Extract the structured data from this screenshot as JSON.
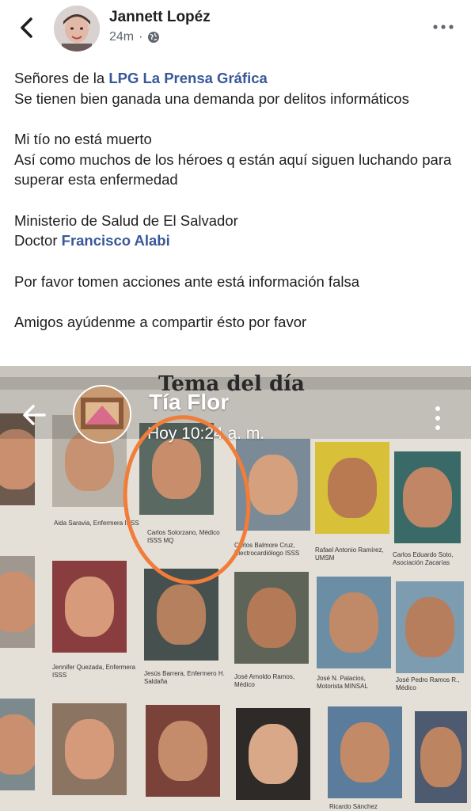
{
  "header": {
    "author": "Jannett Lopéz",
    "time": "24m",
    "back_icon": "chevron-left-icon",
    "privacy_icon": "globe-icon",
    "more_icon": "more-horizontal-icon"
  },
  "post": {
    "line1_prefix": "Señores de la ",
    "line1_link": "LPG La Prensa Gráfica",
    "line2": "Se tienen bien ganada una demanda por delitos informáticos",
    "line3": "Mi tío no está muerto",
    "line4": "Así como muchos de los héroes q están aquí siguen luchando para superar esta enfermedad",
    "line5": "Ministerio de Salud de El Salvador",
    "line6_prefix": "Doctor ",
    "line6_link": "Francisco Alabi",
    "line7": "Por favor  tomen acciones ante está información falsa",
    "line8": "Amigos ayúdenme a compartir ésto por favor",
    "link_color": "#385898"
  },
  "photo": {
    "newspaper_heading": "Tema del día",
    "overlay_name": "Tía Flor",
    "overlay_time": "Hoy 10:24 a. m.",
    "highlight_color": "#f07d3a",
    "captions": [
      "Carlos Solorzano, Médico ISSS MQ",
      "Aida Saravia, Enfermera ISSS",
      "Carlos Balmore Cruz, Electrocardiólogo ISSS",
      "Rafael Antonio Ramírez, UMSM",
      "Carlos Eduardo Soto, Asociación Zacarías",
      "Jennifer Quezada, Enfermera ISSS",
      "Jesús Barrera, Enfermero H. Saldaña",
      "José Arnoldo Ramos, Médico",
      "José N. Palacios, Motorista MINSAL",
      "José Pedro Ramos R., Médico",
      "Ricardo Sánchez"
    ]
  }
}
